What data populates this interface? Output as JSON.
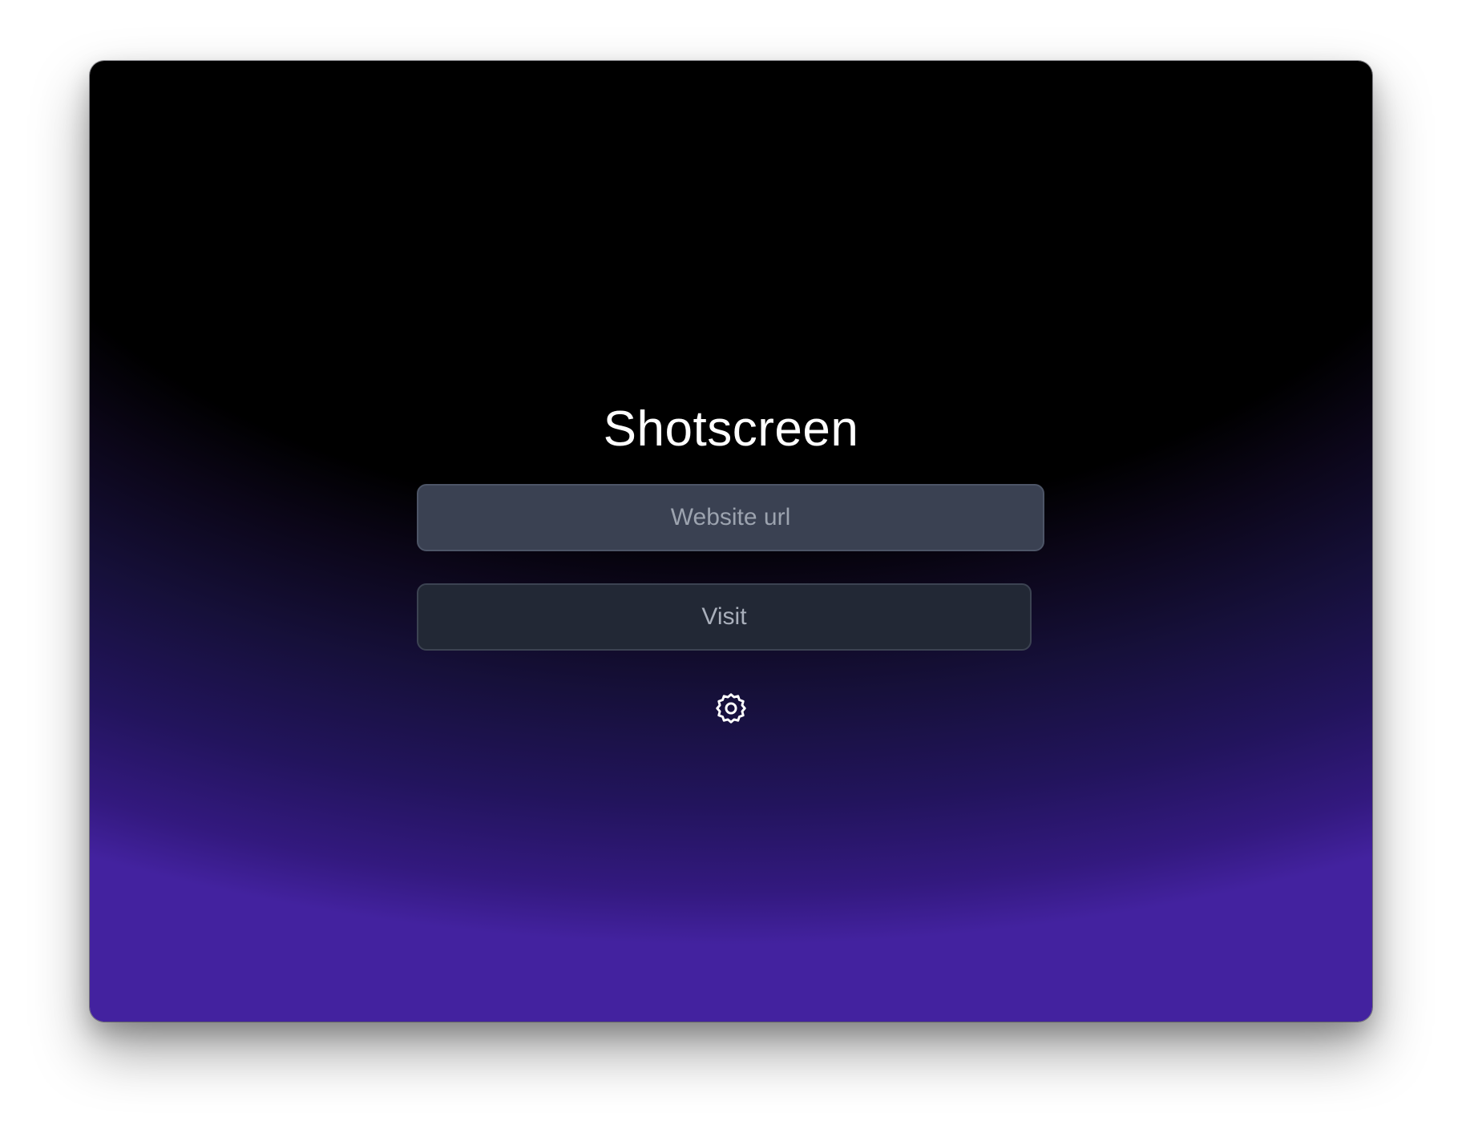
{
  "app": {
    "title": "Shotscreen"
  },
  "form": {
    "url_placeholder": "Website url",
    "url_value": "",
    "visit_label": "Visit"
  },
  "icons": {
    "settings": "gear-icon"
  },
  "colors": {
    "gradient_top": "#000000",
    "gradient_bottom": "#43229f",
    "input_bg": "#3a4152",
    "button_bg": "#222835",
    "title_text": "#ffffff"
  }
}
